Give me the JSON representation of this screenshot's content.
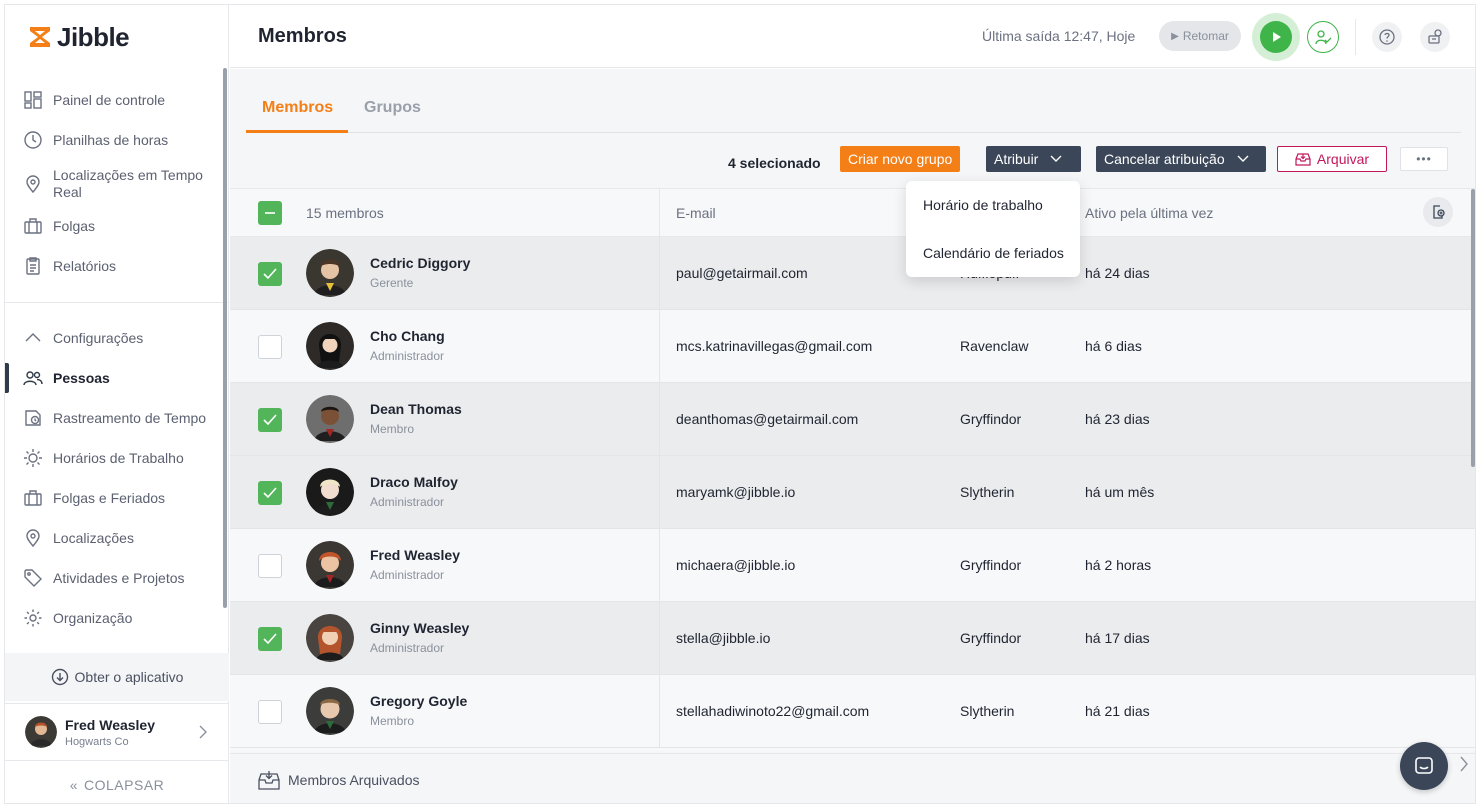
{
  "brand": {
    "name": "Jibble",
    "accent": "#f57f17"
  },
  "sidebar": {
    "items": [
      {
        "label": "Painel de controle",
        "icon": "dashboard-icon"
      },
      {
        "label": "Planilhas de horas",
        "icon": "clock-icon"
      },
      {
        "label": "Localizações em Tempo Real",
        "icon": "location-pin-icon"
      },
      {
        "label": "Folgas",
        "icon": "suitcase-icon"
      },
      {
        "label": "Relatórios",
        "icon": "clipboard-icon"
      }
    ],
    "settings": {
      "label": "Configurações",
      "icon": "chevron-up-icon"
    },
    "settings_items": [
      {
        "label": "Pessoas",
        "icon": "people-icon",
        "active": true
      },
      {
        "label": "Rastreamento de Tempo",
        "icon": "time-tracking-icon"
      },
      {
        "label": "Horários de Trabalho",
        "icon": "sun-schedule-icon"
      },
      {
        "label": "Folgas e Feriados",
        "icon": "suitcase-icon"
      },
      {
        "label": "Localizações",
        "icon": "location-pin-icon"
      },
      {
        "label": "Atividades e Projetos",
        "icon": "tag-icon"
      },
      {
        "label": "Organização",
        "icon": "gear-icon"
      }
    ],
    "get_app": "Obter o aplicativo",
    "user": {
      "name": "Fred Weasley",
      "org": "Hogwarts Co"
    },
    "collapse": "COLAPSAR"
  },
  "header": {
    "title": "Membros",
    "last_out": "Última saída 12:47, Hoje",
    "resume": "Retomar"
  },
  "tabs": [
    {
      "label": "Membros",
      "active": true
    },
    {
      "label": "Grupos",
      "active": false
    }
  ],
  "toolbar": {
    "selected": "4 selecionado",
    "create_group": "Criar novo grupo",
    "assign": "Atribuir",
    "unassign": "Cancelar atribuição",
    "archive": "Arquivar",
    "more": "•••"
  },
  "dropdown": {
    "items": [
      "Horário de trabalho",
      "Calendário de feriados"
    ]
  },
  "table": {
    "header": {
      "members": "15 membros",
      "email": "E-mail",
      "last_active": "Ativo pela última vez"
    },
    "rows": [
      {
        "name": "Cedric Diggory",
        "role": "Gerente",
        "email": "paul@getairmail.com",
        "group": "Hufflepuff",
        "last": "há 24 dias",
        "selected": true
      },
      {
        "name": "Cho Chang",
        "role": "Administrador",
        "email": "mcs.katrinavillegas@gmail.com",
        "group": "Ravenclaw",
        "last": "há 6 dias",
        "selected": false
      },
      {
        "name": "Dean Thomas",
        "role": "Membro",
        "email": "deanthomas@getairmail.com",
        "group": "Gryffindor",
        "last": "há 23 dias",
        "selected": true
      },
      {
        "name": "Draco Malfoy",
        "role": "Administrador",
        "email": "maryamk@jibble.io",
        "group": "Slytherin",
        "last": "há um mês",
        "selected": true
      },
      {
        "name": "Fred Weasley",
        "role": "Administrador",
        "email": "michaera@jibble.io",
        "group": "Gryffindor",
        "last": "há 2 horas",
        "selected": false
      },
      {
        "name": "Ginny Weasley",
        "role": "Administrador",
        "email": "stella@jibble.io",
        "group": "Gryffindor",
        "last": "há 17 dias",
        "selected": true
      },
      {
        "name": "Gregory Goyle",
        "role": "Membro",
        "email": "stellahadiwinoto22@gmail.com",
        "group": "Slytherin",
        "last": "há 21 dias",
        "selected": false
      }
    ]
  },
  "footer": {
    "archived": "Membros Arquivados"
  }
}
